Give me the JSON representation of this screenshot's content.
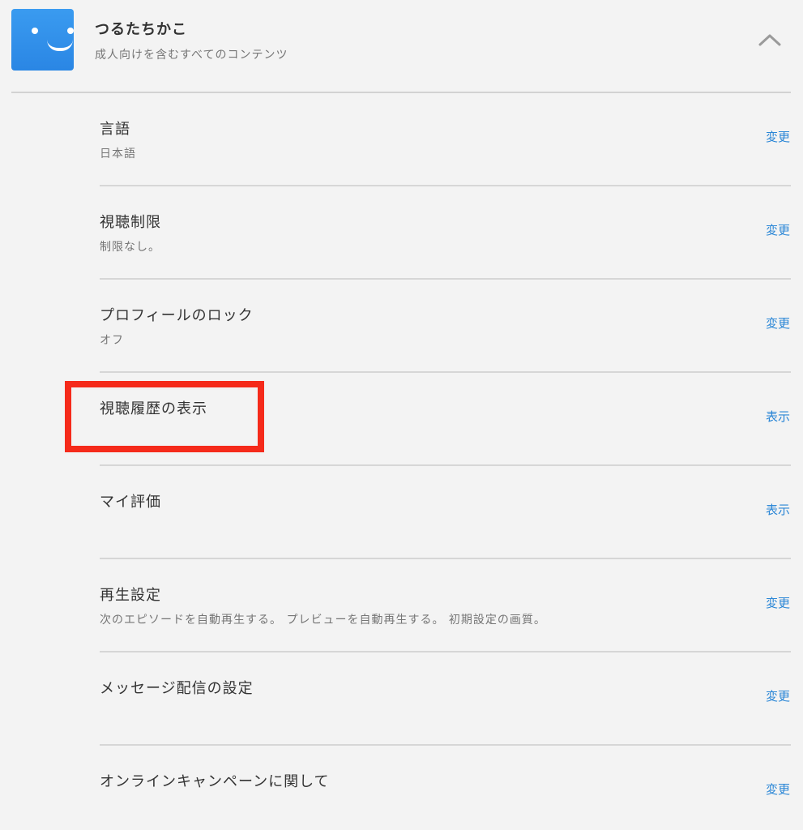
{
  "profile": {
    "name": "つるたちかこ",
    "subtitle": "成人向けを含むすべてのコンテンツ",
    "avatar_icon": "smiley-face-icon",
    "avatar_color": "#2f8fe9",
    "toggle_icon": "chevron-up-icon"
  },
  "settings": [
    {
      "title": "言語",
      "value": "日本語",
      "action": "変更"
    },
    {
      "title": "視聴制限",
      "value": "制限なし。",
      "action": "変更"
    },
    {
      "title": "プロフィールのロック",
      "value": "オフ",
      "action": "変更"
    },
    {
      "title": "視聴履歴の表示",
      "value": "",
      "action": "表示"
    },
    {
      "title": "マイ評価",
      "value": "",
      "action": "表示"
    },
    {
      "title": "再生設定",
      "value": "次のエピソードを自動再生する。 プレビューを自動再生する。 初期設定の画質。",
      "action": "変更"
    },
    {
      "title": "メッセージ配信の設定",
      "value": "",
      "action": "変更"
    },
    {
      "title": "オンラインキャンペーンに関して",
      "value": "",
      "action": "変更"
    }
  ],
  "annotation": {
    "highlight_color": "#f52a1a",
    "highlighted_item": "視聴履歴の表示"
  },
  "colors": {
    "background": "#f3f3f3",
    "link": "#2a86d6",
    "primary_text": "#333333",
    "secondary_text": "#757575"
  }
}
